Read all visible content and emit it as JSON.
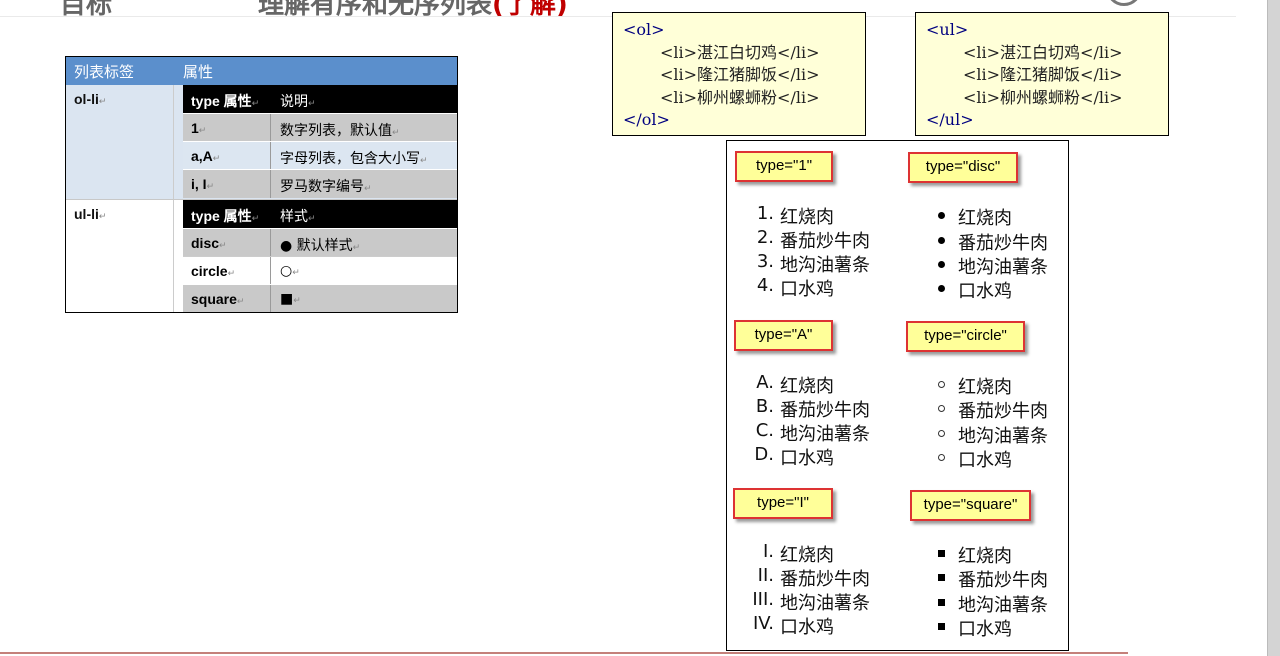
{
  "page": {
    "title_cut_left": "目标",
    "title_cut_main": "理解有序和无序列表",
    "title_cut_accent": "(了解)"
  },
  "table": {
    "headers": [
      "列表标签",
      "属性"
    ],
    "mark": "↵",
    "groups": [
      {
        "tag": "ol-li",
        "inner_header": [
          "type 属性",
          "说明"
        ],
        "rows": [
          [
            "1",
            "数字列表，默认值"
          ],
          [
            "a,A",
            "字母列表，包含大小写"
          ],
          [
            "i, I",
            "罗马数字编号"
          ]
        ]
      },
      {
        "tag": "ul-li",
        "inner_header": [
          "type 属性",
          "样式"
        ],
        "rows": [
          [
            "disc",
            "● 默认样式"
          ],
          [
            "circle",
            "○"
          ],
          [
            "square",
            "■"
          ]
        ]
      }
    ]
  },
  "code_ol": {
    "open": "<ol>",
    "items": [
      "<li>湛江白切鸡</li>",
      "<li>隆江猪脚饭</li>",
      "<li>柳州螺蛳粉</li>"
    ],
    "close": "</ol>"
  },
  "code_ul": {
    "open": "<ul>",
    "items": [
      "<li>湛江白切鸡</li>",
      "<li>隆江猪脚饭</li>",
      "<li>柳州螺蛳粉</li>"
    ],
    "close": "</ul>"
  },
  "demo": {
    "items": [
      "红烧肉",
      "番茄炒牛肉",
      "地沟油薯条",
      "口水鸡"
    ],
    "labels": {
      "num": "type=\"1\"",
      "alpha": "type=\"A\"",
      "roman": "type=\"I\"",
      "disc": "type=\"disc\"",
      "circle": "type=\"circle\"",
      "square": "type=\"square\""
    },
    "markers": {
      "num": [
        "1.",
        "2.",
        "3.",
        "4."
      ],
      "alpha": [
        "A.",
        "B.",
        "C.",
        "D."
      ],
      "roman": [
        "I.",
        "II.",
        "III.",
        "IV."
      ]
    }
  }
}
